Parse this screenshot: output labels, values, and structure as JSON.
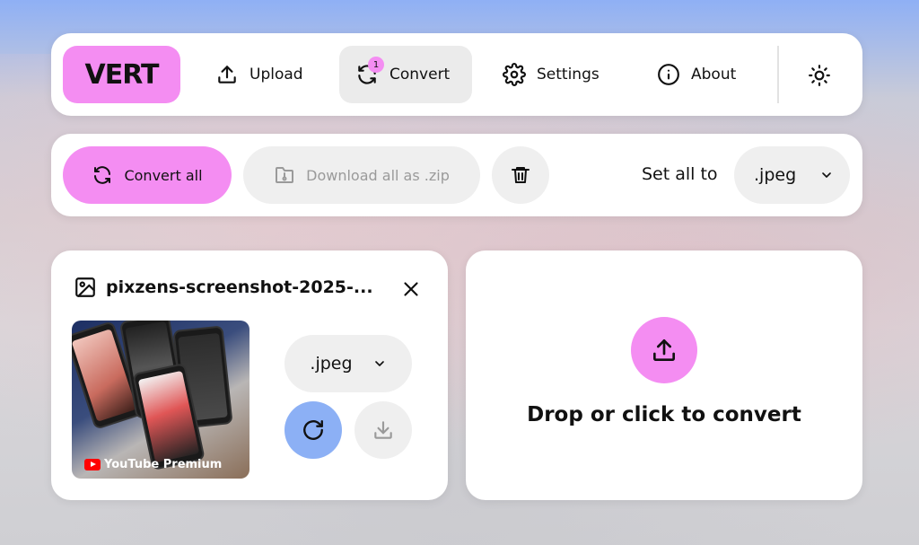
{
  "nav": {
    "logo": "VERT",
    "upload_label": "Upload",
    "convert_label": "Convert",
    "convert_badge": "1",
    "settings_label": "Settings",
    "about_label": "About"
  },
  "toolbar": {
    "convert_all_label": "Convert all",
    "download_zip_label": "Download all as .zip",
    "set_all_label": "Set all to",
    "set_all_value": ".jpeg"
  },
  "file": {
    "name": "pixzens-screenshot-2025-...",
    "format": ".jpeg",
    "thumbnail_caption": "YouTube Premium"
  },
  "dropzone": {
    "text": "Drop or click to convert"
  },
  "colors": {
    "accent_pink": "#f48df2",
    "accent_blue": "#8cb0f5",
    "pill_gray": "#efefef"
  }
}
